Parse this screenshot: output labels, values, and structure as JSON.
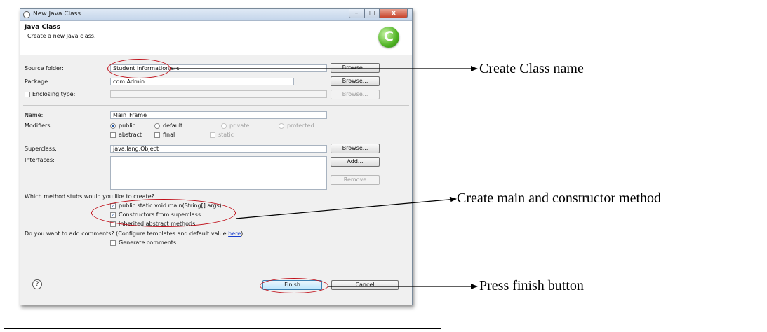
{
  "dialog": {
    "window_title": "New Java Class",
    "window_buttons": {
      "minimize": "–",
      "maximize": "□",
      "close": "x"
    },
    "header_title": "Java Class",
    "header_subtitle": "Create a new Java class.",
    "logo_icon": "new-class-icon",
    "logo_glyph": "C"
  },
  "form": {
    "source_folder": {
      "label": "Source folder:",
      "value": "Student information/src",
      "button": "Browse..."
    },
    "package": {
      "label": "Package:",
      "value": "com.Admin",
      "button": "Browse..."
    },
    "enclosing_type": {
      "label": "Enclosing type:",
      "value": "",
      "checked": false,
      "button": "Browse..."
    },
    "name": {
      "label": "Name:",
      "value": "Main_Frame"
    },
    "modifiers": {
      "label": "Modifiers:",
      "access": [
        {
          "label": "public",
          "selected": true,
          "enabled": true
        },
        {
          "label": "default",
          "selected": false,
          "enabled": true
        },
        {
          "label": "private",
          "selected": false,
          "enabled": false
        },
        {
          "label": "protected",
          "selected": false,
          "enabled": false
        }
      ],
      "other": [
        {
          "label": "abstract",
          "checked": false,
          "enabled": true
        },
        {
          "label": "final",
          "checked": false,
          "enabled": true
        },
        {
          "label": "static",
          "checked": false,
          "enabled": false
        }
      ]
    },
    "superclass": {
      "label": "Superclass:",
      "value": "java.lang.Object",
      "button": "Browse..."
    },
    "interfaces": {
      "label": "Interfaces:",
      "add_button": "Add...",
      "remove_button": "Remove"
    },
    "stubs": {
      "question": "Which method stubs would you like to create?",
      "options": [
        {
          "label": "public static void main(String[] args)",
          "checked": true
        },
        {
          "label": "Constructors from superclass",
          "checked": true
        },
        {
          "label": "Inherited abstract methods",
          "checked": false
        }
      ]
    },
    "comments": {
      "question_prefix": "Do you want to add comments? (Configure templates and default value ",
      "link": "here",
      "question_suffix": ")",
      "option": {
        "label": "Generate comments",
        "checked": false
      }
    }
  },
  "footer": {
    "help_icon": "help-icon",
    "help_glyph": "?",
    "finish": "Finish",
    "cancel": "Cancel"
  },
  "annotations": {
    "class_name": "Create Class name",
    "main_constructor": "Create main and constructor method",
    "finish": "Press finish button",
    "highlight_color": "#c0101a"
  }
}
